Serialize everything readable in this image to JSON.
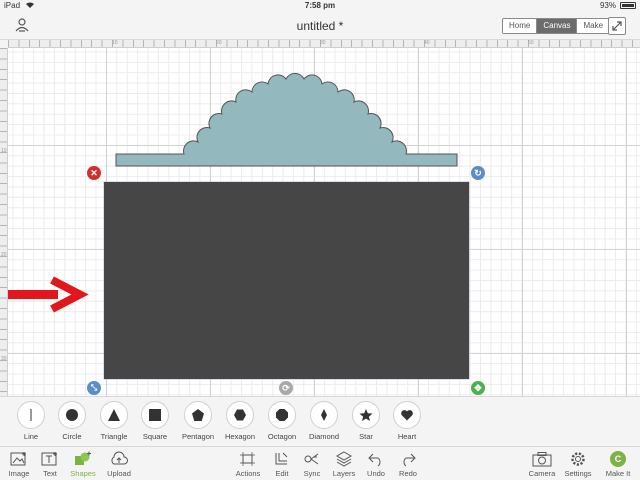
{
  "status": {
    "carrier": "iPad",
    "time": "7:58 pm",
    "battery": "93%"
  },
  "header": {
    "title": "untitled *",
    "tabs": [
      {
        "label": "Home",
        "active": false
      },
      {
        "label": "Canvas",
        "active": true
      },
      {
        "label": "Make",
        "active": false
      }
    ],
    "account_icon": "account-sync-icon",
    "expand_icon": "expand-icon"
  },
  "rulers": {
    "top": [
      "10",
      "20",
      "30",
      "40",
      "50"
    ],
    "left": [
      "10",
      "20",
      "30"
    ]
  },
  "colors": {
    "scallop_fill": "#93b8bd",
    "rectangle_fill": "#464646",
    "delete_handle": "#d32f2f",
    "rotate_handle": "#5b8ec9",
    "resize_handle": "#5b8ec9",
    "move_handle": "#4caf50",
    "unlock_handle": "#a9a9a9",
    "arrow": "#e3171b",
    "accent": "#7cb342"
  },
  "shapes": [
    {
      "label": "Line",
      "icon": "line-icon"
    },
    {
      "label": "Circle",
      "icon": "circle-icon"
    },
    {
      "label": "Triangle",
      "icon": "triangle-icon"
    },
    {
      "label": "Square",
      "icon": "square-icon"
    },
    {
      "label": "Pentagon",
      "icon": "pentagon-icon"
    },
    {
      "label": "Hexagon",
      "icon": "hexagon-icon"
    },
    {
      "label": "Octagon",
      "icon": "octagon-icon"
    },
    {
      "label": "Diamond",
      "icon": "diamond-icon"
    },
    {
      "label": "Star",
      "icon": "star-icon"
    },
    {
      "label": "Heart",
      "icon": "heart-icon"
    }
  ],
  "toolbar": {
    "image": "Image",
    "text": "Text",
    "shapes": "Shapes",
    "upload": "Upload",
    "actions": "Actions",
    "edit": "Edit",
    "sync": "Sync",
    "layers": "Layers",
    "undo": "Undo",
    "redo": "Redo",
    "camera": "Camera",
    "settings": "Settings",
    "make_it": "Make It",
    "make_it_badge": "C"
  }
}
